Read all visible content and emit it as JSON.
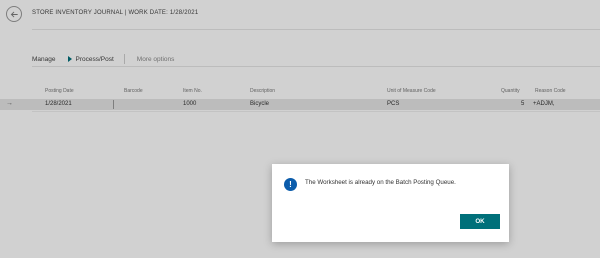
{
  "header": {
    "title": "STORE INVENTORY JOURNAL | WORK DATE: 1/28/2021",
    "back_icon": "arrow-left-icon"
  },
  "actions": {
    "manage_label": "Manage",
    "process_label": "Process/Post",
    "more_label": "More options",
    "process_icon": "play-icon"
  },
  "grid": {
    "columns": [
      "Posting Date",
      "Barcode",
      "Item No.",
      "Description",
      "Unit of Measure Code",
      "Quantity",
      "Reason Code"
    ],
    "rows": [
      {
        "arrow": "→",
        "posting_date": "1/28/2021",
        "barcode": "",
        "item_no": "1000",
        "description": "Bicycle",
        "uom": "PCS",
        "quantity": "5",
        "reason_code": "+ADJM,"
      }
    ]
  },
  "dialog": {
    "icon": "info-icon",
    "icon_glyph": "!",
    "message": "The Worksheet is already on the Batch Posting Queue.",
    "ok_label": "OK"
  },
  "colors": {
    "accent": "#00707a",
    "info": "#0b5cab",
    "selected_row": "#e6e6e6"
  }
}
